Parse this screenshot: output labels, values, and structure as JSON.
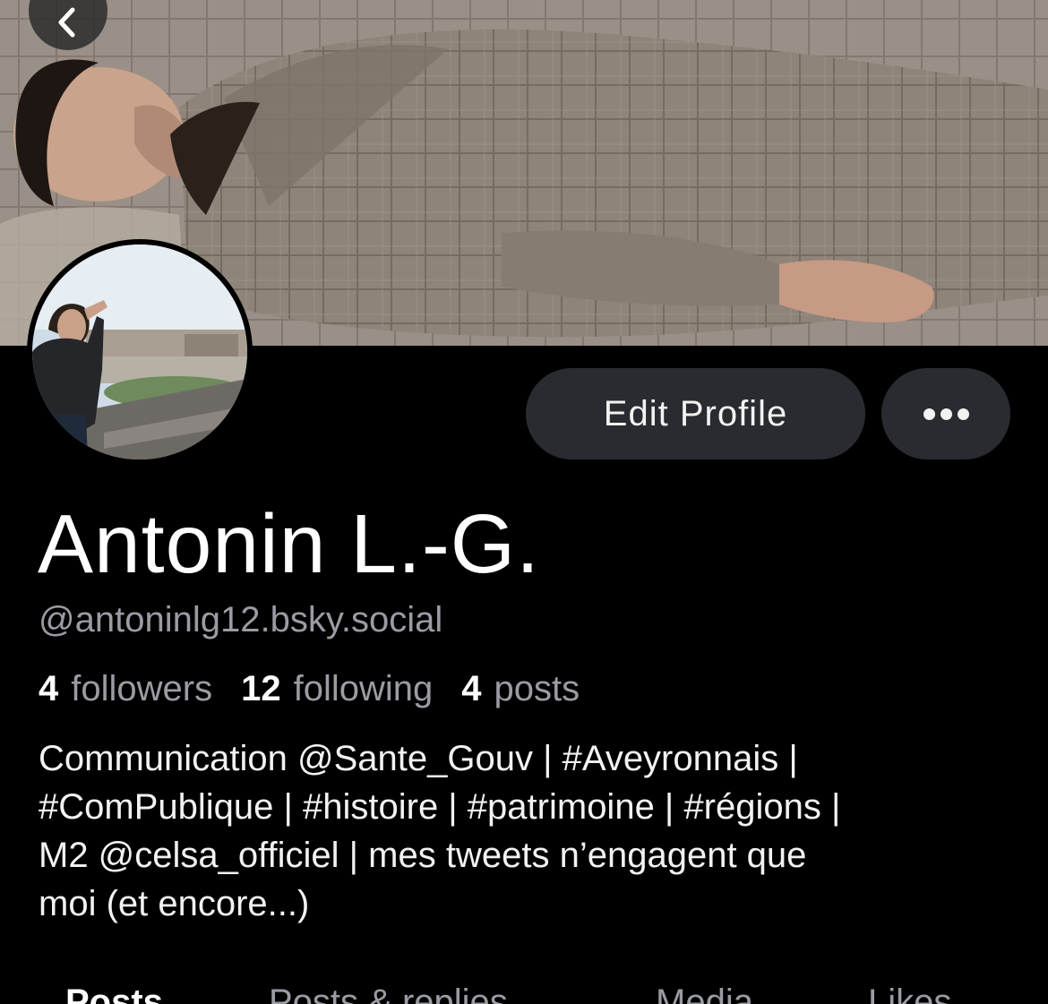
{
  "profile": {
    "display_name": "Antonin L.-G.",
    "handle": "@antoninlg12.bsky.social",
    "bio_lines": [
      "Communication @Sante_Gouv | #Aveyronnais |",
      "#ComPublique | #histoire | #patrimoine | #régions |",
      "M2 @celsa_officiel | mes tweets n’engagent que",
      "moi (et encore...)"
    ]
  },
  "stats": {
    "followers_count": "4",
    "followers_label": "followers",
    "following_count": "12",
    "following_label": "following",
    "posts_count": "4",
    "posts_label": "posts"
  },
  "actions": {
    "edit_profile_label": "Edit Profile"
  },
  "tabs": [
    {
      "label": "Posts",
      "active": true
    },
    {
      "label": "Posts & replies",
      "active": false
    },
    {
      "label": "Media",
      "active": false
    },
    {
      "label": "Likes",
      "active": false
    }
  ],
  "icons": {
    "back": "chevron-left-icon",
    "more": "ellipsis-icon"
  },
  "colors": {
    "background": "#000000",
    "button_bg": "#2a2b30",
    "muted_text": "#9b9ca3"
  }
}
